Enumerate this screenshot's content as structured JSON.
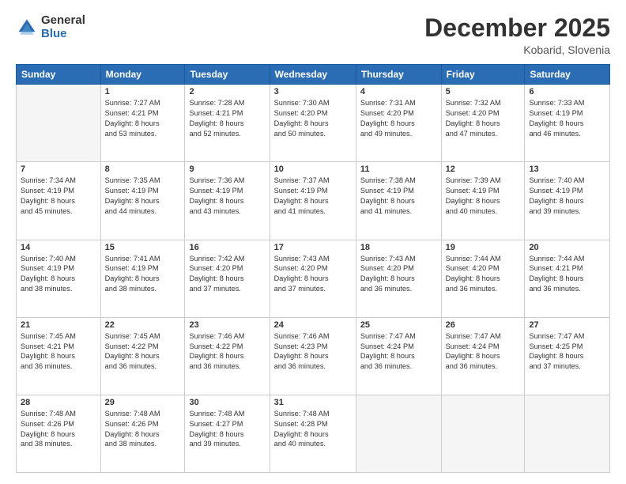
{
  "logo": {
    "general": "General",
    "blue": "Blue"
  },
  "header": {
    "month": "December 2025",
    "location": "Kobarid, Slovenia"
  },
  "days_of_week": [
    "Sunday",
    "Monday",
    "Tuesday",
    "Wednesday",
    "Thursday",
    "Friday",
    "Saturday"
  ],
  "weeks": [
    [
      {
        "num": "",
        "text": ""
      },
      {
        "num": "1",
        "text": "Sunrise: 7:27 AM\nSunset: 4:21 PM\nDaylight: 8 hours\nand 53 minutes."
      },
      {
        "num": "2",
        "text": "Sunrise: 7:28 AM\nSunset: 4:21 PM\nDaylight: 8 hours\nand 52 minutes."
      },
      {
        "num": "3",
        "text": "Sunrise: 7:30 AM\nSunset: 4:20 PM\nDaylight: 8 hours\nand 50 minutes."
      },
      {
        "num": "4",
        "text": "Sunrise: 7:31 AM\nSunset: 4:20 PM\nDaylight: 8 hours\nand 49 minutes."
      },
      {
        "num": "5",
        "text": "Sunrise: 7:32 AM\nSunset: 4:20 PM\nDaylight: 8 hours\nand 47 minutes."
      },
      {
        "num": "6",
        "text": "Sunrise: 7:33 AM\nSunset: 4:19 PM\nDaylight: 8 hours\nand 46 minutes."
      }
    ],
    [
      {
        "num": "7",
        "text": "Sunrise: 7:34 AM\nSunset: 4:19 PM\nDaylight: 8 hours\nand 45 minutes."
      },
      {
        "num": "8",
        "text": "Sunrise: 7:35 AM\nSunset: 4:19 PM\nDaylight: 8 hours\nand 44 minutes."
      },
      {
        "num": "9",
        "text": "Sunrise: 7:36 AM\nSunset: 4:19 PM\nDaylight: 8 hours\nand 43 minutes."
      },
      {
        "num": "10",
        "text": "Sunrise: 7:37 AM\nSunset: 4:19 PM\nDaylight: 8 hours\nand 41 minutes."
      },
      {
        "num": "11",
        "text": "Sunrise: 7:38 AM\nSunset: 4:19 PM\nDaylight: 8 hours\nand 41 minutes."
      },
      {
        "num": "12",
        "text": "Sunrise: 7:39 AM\nSunset: 4:19 PM\nDaylight: 8 hours\nand 40 minutes."
      },
      {
        "num": "13",
        "text": "Sunrise: 7:40 AM\nSunset: 4:19 PM\nDaylight: 8 hours\nand 39 minutes."
      }
    ],
    [
      {
        "num": "14",
        "text": "Sunrise: 7:40 AM\nSunset: 4:19 PM\nDaylight: 8 hours\nand 38 minutes."
      },
      {
        "num": "15",
        "text": "Sunrise: 7:41 AM\nSunset: 4:19 PM\nDaylight: 8 hours\nand 38 minutes."
      },
      {
        "num": "16",
        "text": "Sunrise: 7:42 AM\nSunset: 4:20 PM\nDaylight: 8 hours\nand 37 minutes."
      },
      {
        "num": "17",
        "text": "Sunrise: 7:43 AM\nSunset: 4:20 PM\nDaylight: 8 hours\nand 37 minutes."
      },
      {
        "num": "18",
        "text": "Sunrise: 7:43 AM\nSunset: 4:20 PM\nDaylight: 8 hours\nand 36 minutes."
      },
      {
        "num": "19",
        "text": "Sunrise: 7:44 AM\nSunset: 4:20 PM\nDaylight: 8 hours\nand 36 minutes."
      },
      {
        "num": "20",
        "text": "Sunrise: 7:44 AM\nSunset: 4:21 PM\nDaylight: 8 hours\nand 36 minutes."
      }
    ],
    [
      {
        "num": "21",
        "text": "Sunrise: 7:45 AM\nSunset: 4:21 PM\nDaylight: 8 hours\nand 36 minutes."
      },
      {
        "num": "22",
        "text": "Sunrise: 7:45 AM\nSunset: 4:22 PM\nDaylight: 8 hours\nand 36 minutes."
      },
      {
        "num": "23",
        "text": "Sunrise: 7:46 AM\nSunset: 4:22 PM\nDaylight: 8 hours\nand 36 minutes."
      },
      {
        "num": "24",
        "text": "Sunrise: 7:46 AM\nSunset: 4:23 PM\nDaylight: 8 hours\nand 36 minutes."
      },
      {
        "num": "25",
        "text": "Sunrise: 7:47 AM\nSunset: 4:24 PM\nDaylight: 8 hours\nand 36 minutes."
      },
      {
        "num": "26",
        "text": "Sunrise: 7:47 AM\nSunset: 4:24 PM\nDaylight: 8 hours\nand 36 minutes."
      },
      {
        "num": "27",
        "text": "Sunrise: 7:47 AM\nSunset: 4:25 PM\nDaylight: 8 hours\nand 37 minutes."
      }
    ],
    [
      {
        "num": "28",
        "text": "Sunrise: 7:48 AM\nSunset: 4:26 PM\nDaylight: 8 hours\nand 38 minutes."
      },
      {
        "num": "29",
        "text": "Sunrise: 7:48 AM\nSunset: 4:26 PM\nDaylight: 8 hours\nand 38 minutes."
      },
      {
        "num": "30",
        "text": "Sunrise: 7:48 AM\nSunset: 4:27 PM\nDaylight: 8 hours\nand 39 minutes."
      },
      {
        "num": "31",
        "text": "Sunrise: 7:48 AM\nSunset: 4:28 PM\nDaylight: 8 hours\nand 40 minutes."
      },
      {
        "num": "",
        "text": ""
      },
      {
        "num": "",
        "text": ""
      },
      {
        "num": "",
        "text": ""
      }
    ]
  ]
}
